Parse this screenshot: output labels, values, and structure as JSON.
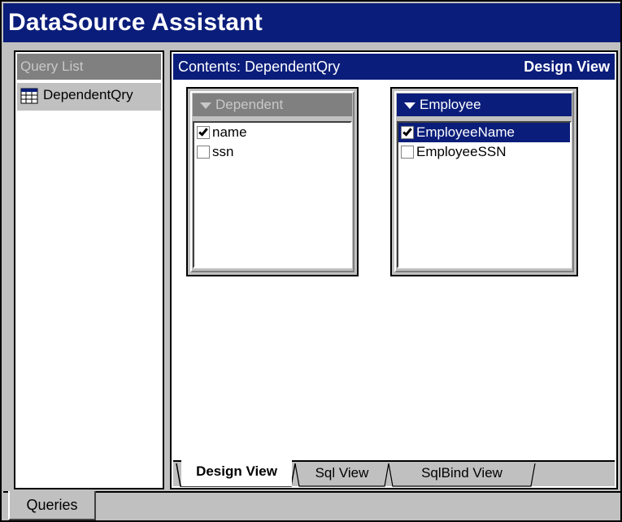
{
  "app": {
    "title": "DataSource Assistant"
  },
  "left_pane": {
    "header": "Query List",
    "items": [
      {
        "label": "DependentQry",
        "icon": "query-grid-icon"
      }
    ]
  },
  "right_pane": {
    "header_prefix": "Contents: DependentQry",
    "view_label": "Design View",
    "tables": [
      {
        "name": "Dependent",
        "active": false,
        "fields": [
          {
            "label": "name",
            "checked": true
          },
          {
            "label": "ssn",
            "checked": false
          }
        ]
      },
      {
        "name": "Employee",
        "active": true,
        "fields": [
          {
            "label": "EmployeeName",
            "checked": true,
            "selected": true
          },
          {
            "label": "EmployeeSSN",
            "checked": false
          }
        ]
      }
    ],
    "tabs": [
      "Design View",
      "Sql View",
      "SqlBind View"
    ],
    "active_tab": "Design View"
  },
  "bottom": {
    "tab_label": "Queries"
  }
}
